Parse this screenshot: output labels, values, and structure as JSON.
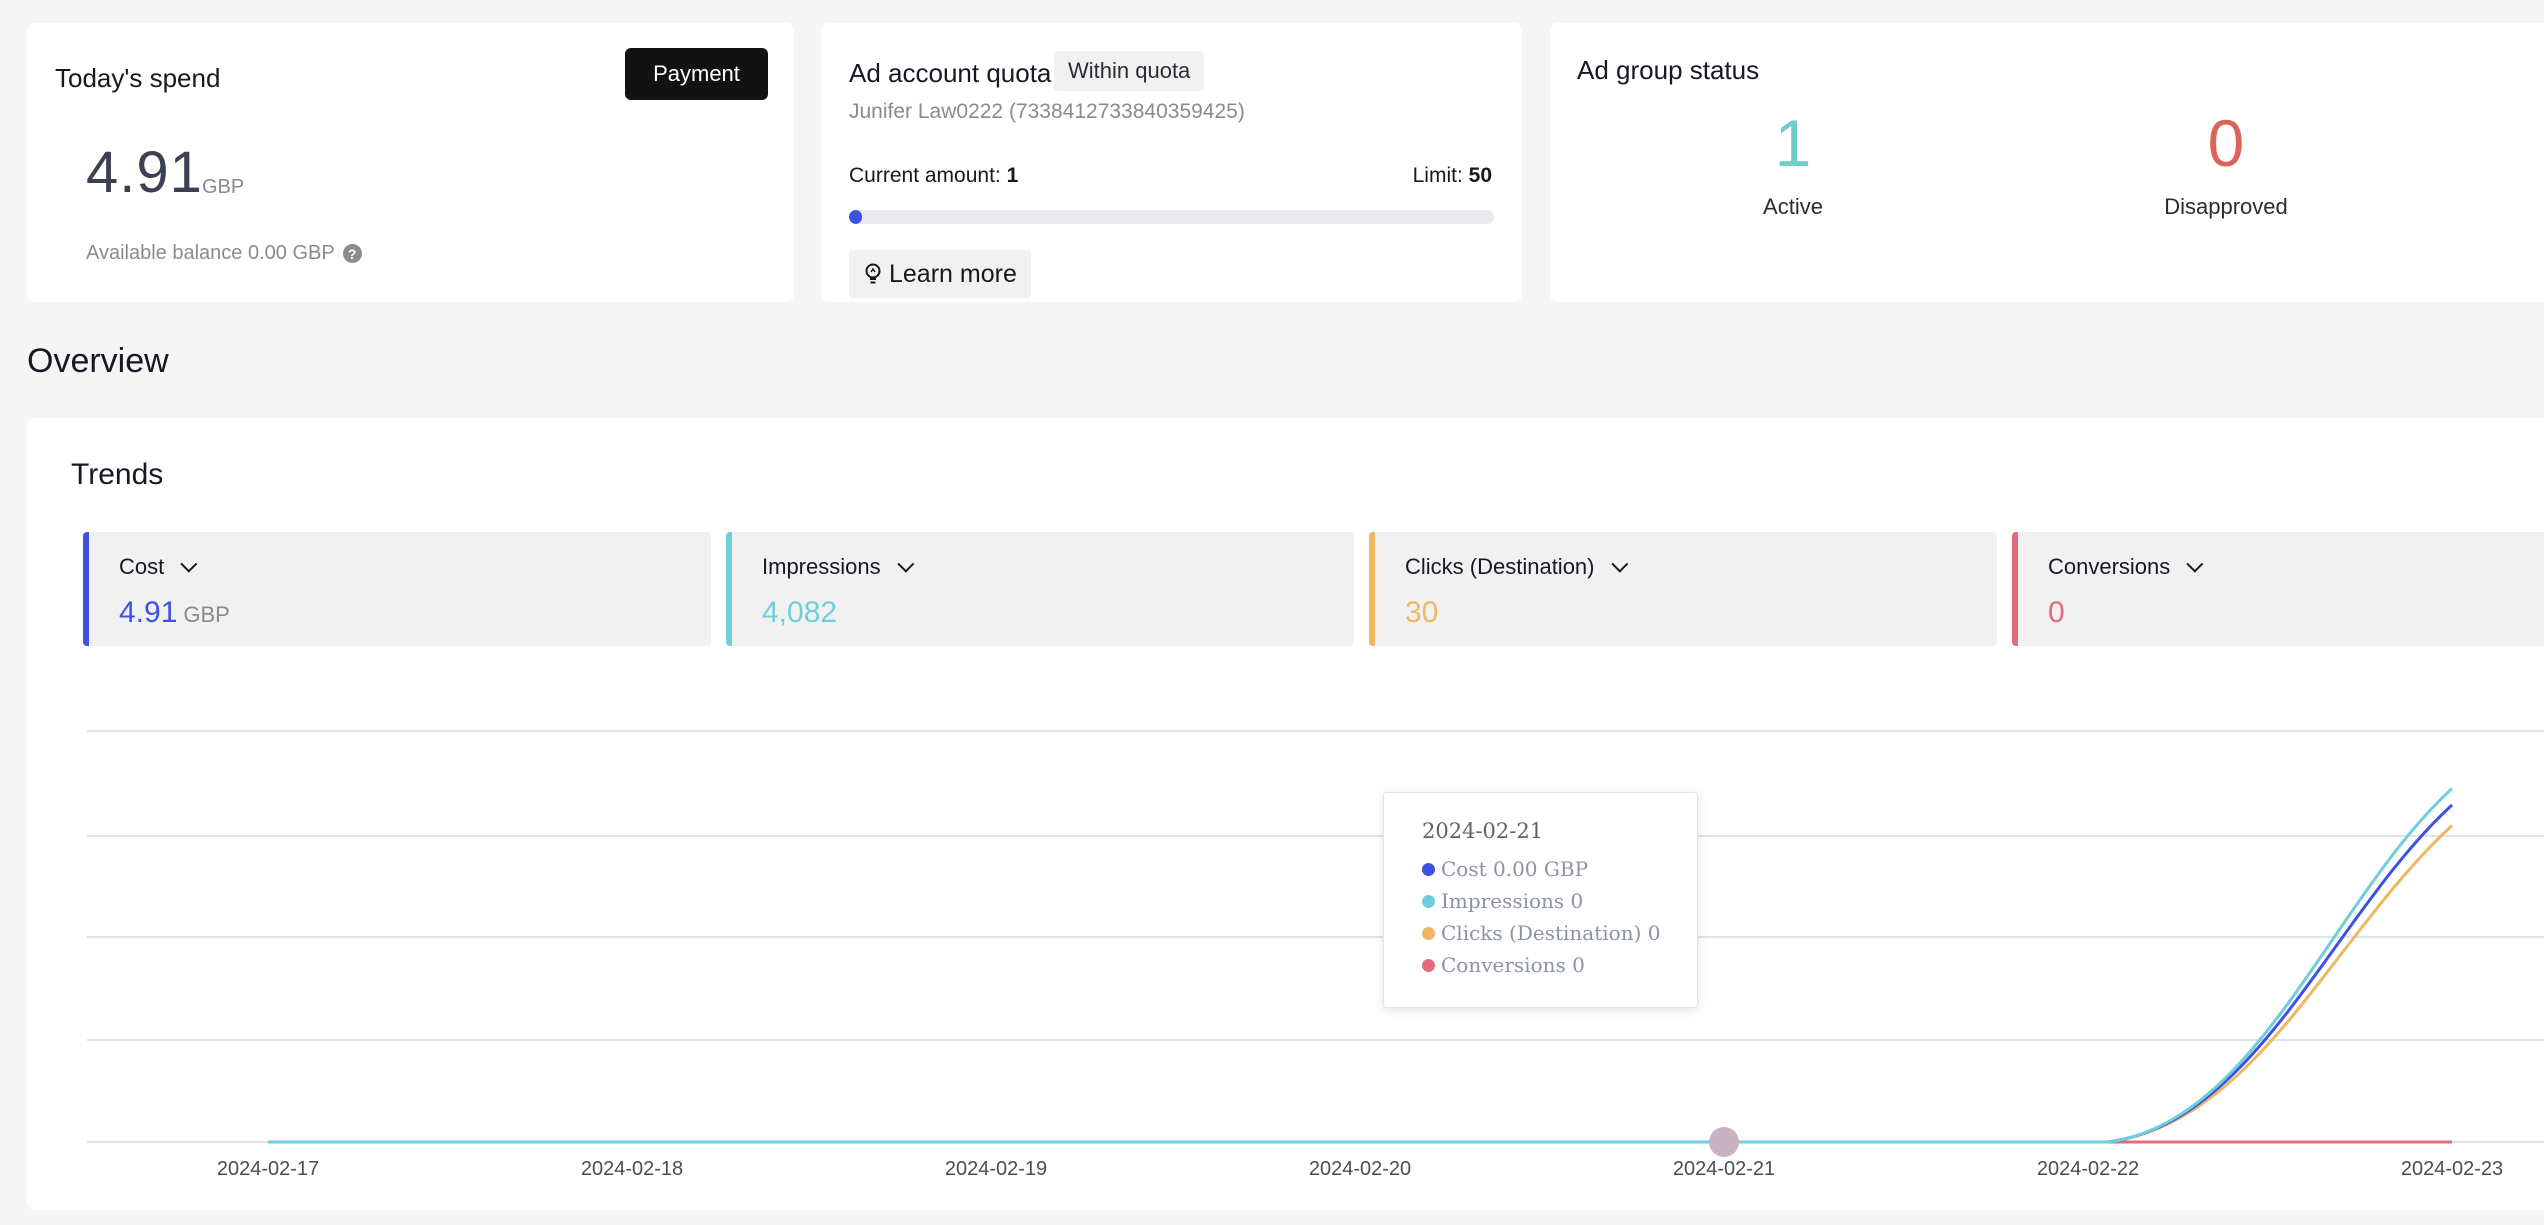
{
  "spend": {
    "title": "Today's spend",
    "payment_label": "Payment",
    "value": "4.91",
    "unit": "GBP",
    "balance": "Available balance 0.00 GBP",
    "help_icon": "?"
  },
  "quota": {
    "title": "Ad account quota",
    "badge": "Within quota",
    "account": "Junifer Law0222 (7338412733840359425)",
    "current_label": "Current amount:",
    "current_value": "1",
    "limit_label": "Limit:",
    "limit_value": "50",
    "fill_fraction": 0.02,
    "learn_more": "Learn more"
  },
  "ad_group_status": {
    "title": "Ad group status",
    "active_count": "1",
    "active_label": "Active",
    "disapproved_count": "0",
    "disapproved_label": "Disapproved"
  },
  "overview": {
    "title": "Overview"
  },
  "trends": {
    "title": "Trends",
    "metrics": [
      {
        "label": "Cost",
        "value": "4.91",
        "unit": "GBP",
        "color": "#3f51e0"
      },
      {
        "label": "Impressions",
        "value": "4,082",
        "unit": "",
        "color": "#6ecfdb"
      },
      {
        "label": "Clicks (Destination)",
        "value": "30",
        "unit": "",
        "color": "#efb764"
      },
      {
        "label": "Conversions",
        "value": "0",
        "unit": "",
        "color": "#e06c7c"
      }
    ]
  },
  "tooltip": {
    "date": "2024-02-21",
    "rows": [
      {
        "text": "Cost 0.00 GBP",
        "color": "#3f51e0"
      },
      {
        "text": "Impressions 0",
        "color": "#6ecfdb"
      },
      {
        "text": "Clicks (Destination) 0",
        "color": "#efb764"
      },
      {
        "text": "Conversions 0",
        "color": "#e06c7c"
      }
    ]
  },
  "chart_data": {
    "type": "line",
    "x": [
      "2024-02-17",
      "2024-02-18",
      "2024-02-19",
      "2024-02-20",
      "2024-02-21",
      "2024-02-22",
      "2024-02-23"
    ],
    "series": [
      {
        "name": "Cost",
        "values": [
          0,
          0,
          0,
          0,
          0,
          0,
          4.91
        ],
        "color": "#3f51e0",
        "peak_fraction": 0.82
      },
      {
        "name": "Impressions",
        "values": [
          0,
          0,
          0,
          0,
          0,
          0,
          4082
        ],
        "color": "#6ecfdb",
        "peak_fraction": 0.86
      },
      {
        "name": "Clicks (Destination)",
        "values": [
          0,
          0,
          0,
          0,
          0,
          0,
          30
        ],
        "color": "#efb764",
        "peak_fraction": 0.77
      },
      {
        "name": "Conversions",
        "values": [
          0,
          0,
          0,
          0,
          0,
          0,
          0
        ],
        "color": "#e06c7c",
        "peak_fraction": 0
      }
    ],
    "hover_index": 4,
    "grid": true,
    "legend": "none"
  }
}
